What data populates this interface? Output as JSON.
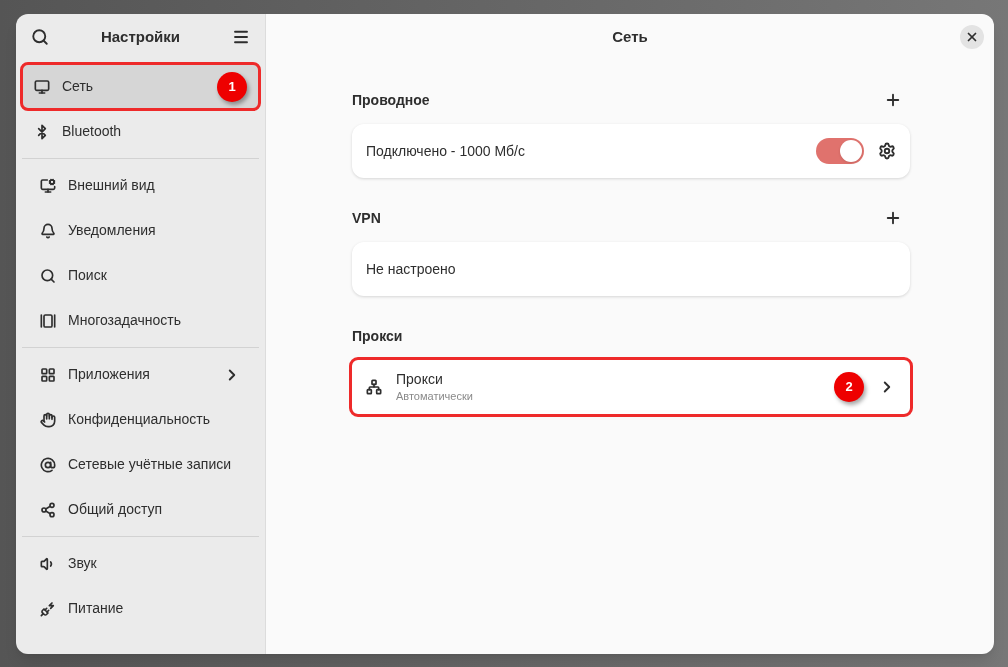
{
  "sidebar": {
    "title": "Настройки",
    "groups": [
      [
        {
          "label": "Сеть",
          "selected": true,
          "annotation": "1"
        },
        {
          "label": "Bluetooth",
          "selected": false
        }
      ],
      [
        {
          "label": "Внешний вид",
          "selected": false
        },
        {
          "label": "Уведомления",
          "selected": false
        },
        {
          "label": "Поиск",
          "selected": false
        },
        {
          "label": "Многозадачность",
          "selected": false
        }
      ],
      [
        {
          "label": "Приложения",
          "selected": false,
          "submenu": true
        },
        {
          "label": "Конфиденциальность",
          "selected": false
        },
        {
          "label": "Сетевые учётные записи",
          "selected": false
        },
        {
          "label": "Общий доступ",
          "selected": false
        }
      ],
      [
        {
          "label": "Звук",
          "selected": false
        },
        {
          "label": "Питание",
          "selected": false
        }
      ]
    ]
  },
  "content": {
    "title": "Сеть",
    "sections": [
      {
        "heading": "Проводное",
        "addable": true,
        "row": {
          "kind": "connection",
          "label": "Подключено - 1000 Мб/с",
          "on": true
        }
      },
      {
        "heading": "VPN",
        "addable": true,
        "row": {
          "kind": "text",
          "label": "Не настроено"
        }
      },
      {
        "heading": "Прокси",
        "row": {
          "kind": "link",
          "label": "Прокси",
          "subtitle": "Автоматически",
          "annotation": "2"
        }
      }
    ]
  }
}
